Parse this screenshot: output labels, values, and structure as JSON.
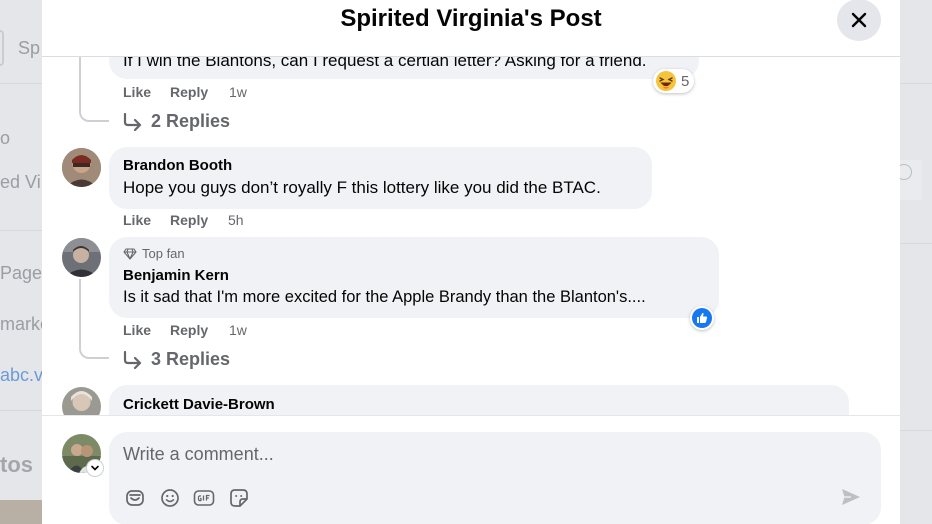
{
  "dialog": {
    "title": "Spirited Virginia's Post"
  },
  "background": {
    "fragments": [
      "Sp",
      "o",
      "ed Vi",
      "Page ·",
      "marke",
      "abc.vi",
      "tos"
    ]
  },
  "comments": [
    {
      "text": "If I win the Blantons, can I request a certian letter? Asking for a friend.",
      "like": "Like",
      "reply": "Reply",
      "time": "1w",
      "reaction_count": "5",
      "replies_label": "2 Replies"
    },
    {
      "author": "Brandon Booth",
      "text": "Hope you guys don’t royally F this lottery like you did the BTAC.",
      "like": "Like",
      "reply": "Reply",
      "time": "5h"
    },
    {
      "badge": "Top fan",
      "author": "Benjamin Kern",
      "text": "Is it sad that I'm more excited for the Apple Brandy than the Blanton's....",
      "like": "Like",
      "reply": "Reply",
      "time": "1w",
      "replies_label": "3 Replies"
    },
    {
      "author": "Crickett Davie-Brown"
    }
  ],
  "composer": {
    "placeholder": "Write a comment..."
  },
  "colors": {
    "bubble": "#f0f2f5",
    "secondary_text": "#65676b",
    "like_blue": "#1877f2"
  }
}
